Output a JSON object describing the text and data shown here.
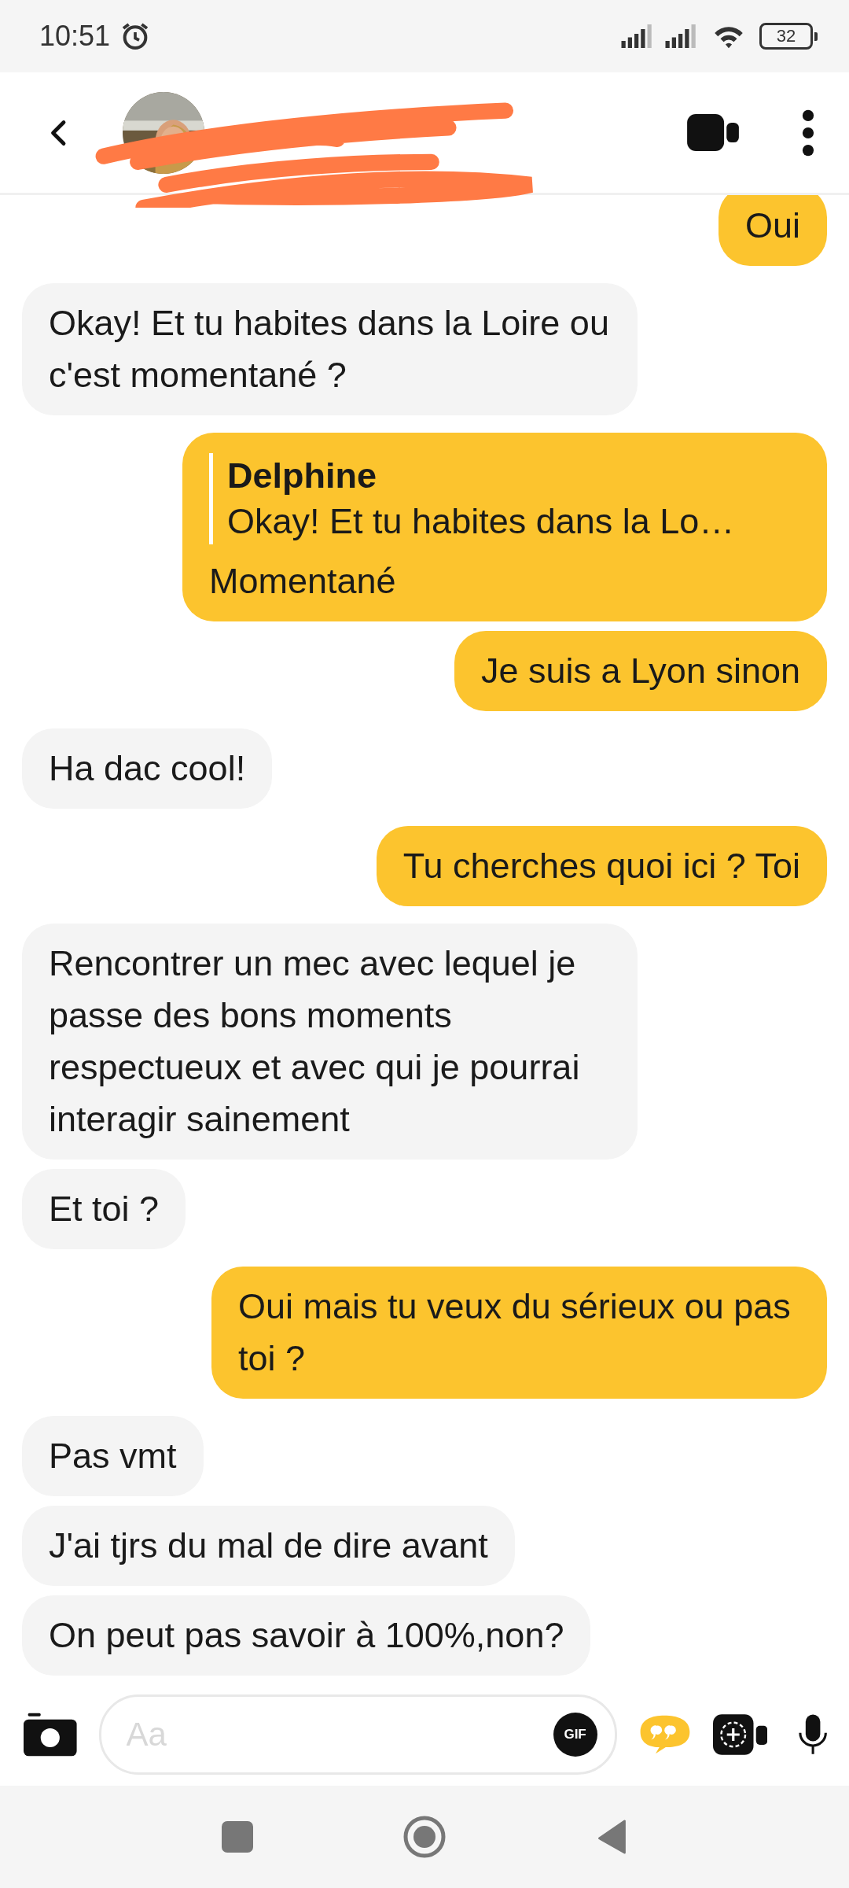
{
  "status_bar": {
    "time": "10:51",
    "battery": "32"
  },
  "messages": [
    {
      "outgoing": true,
      "text": "Oui"
    },
    {
      "outgoing": false,
      "text": "Okay! Et tu habites dans la Loire ou c'est momentané ?"
    },
    {
      "outgoing": true,
      "text": "Momentané",
      "reply": {
        "author": "Delphine",
        "text": "Okay! Et tu habites dans la Lo…"
      }
    },
    {
      "outgoing": true,
      "text": "Je suis a Lyon sinon"
    },
    {
      "outgoing": false,
      "text": "Ha dac cool!"
    },
    {
      "outgoing": true,
      "text": "Tu cherches quoi ici ? Toi"
    },
    {
      "outgoing": false,
      "text": "Rencontrer un mec avec lequel je passe des bons moments respectueux et avec qui je pourrai interagir sainement"
    },
    {
      "outgoing": false,
      "text": "Et toi ?"
    },
    {
      "outgoing": true,
      "text": "Oui mais tu veux du sérieux ou pas toi ?"
    },
    {
      "outgoing": false,
      "text": "Pas vmt"
    },
    {
      "outgoing": false,
      "text": "J'ai tjrs du mal de dire avant"
    },
    {
      "outgoing": false,
      "text": "On peut pas savoir à 100%,non?"
    }
  ],
  "composer": {
    "placeholder": "Aa",
    "gif_label": "GIF"
  }
}
